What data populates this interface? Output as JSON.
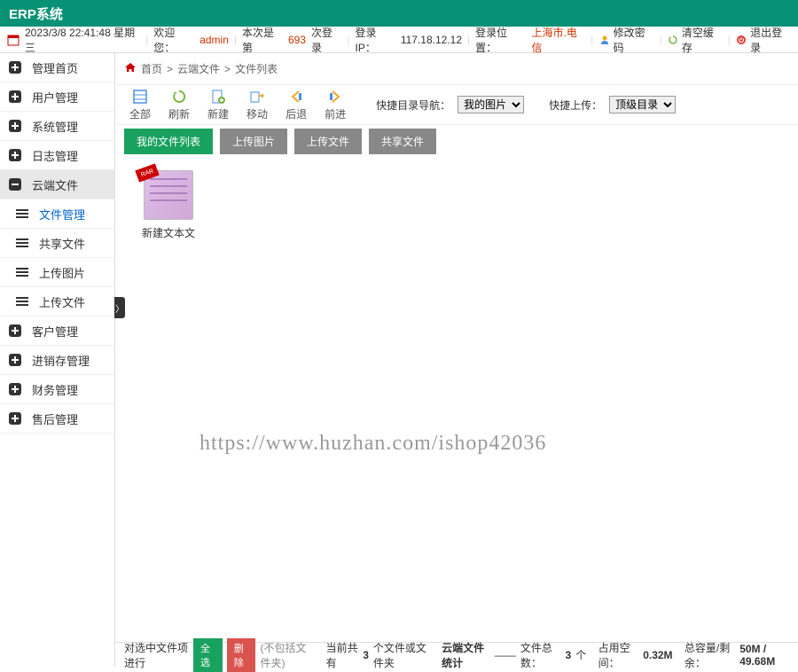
{
  "app_title": "ERP系统",
  "info_bar": {
    "datetime": "2023/3/8 22:41:48 星期三",
    "welcome": "欢迎您：",
    "user": "admin",
    "login_count_pre": "本次是第",
    "login_count": "693",
    "login_count_post": "次登录",
    "login_ip_label": "登录IP：",
    "login_ip": "117.18.12.12",
    "login_loc_label": "登录位置：",
    "login_loc": "上海市.电信",
    "change_pwd": "修改密码",
    "clear_cache": "清空缓存",
    "logout": "退出登录"
  },
  "sidebar": {
    "items": [
      {
        "label": "管理首页",
        "type": "plus"
      },
      {
        "label": "用户管理",
        "type": "plus"
      },
      {
        "label": "系统管理",
        "type": "plus"
      },
      {
        "label": "日志管理",
        "type": "plus"
      },
      {
        "label": "云端文件",
        "type": "minus",
        "section_active": true
      },
      {
        "label": "文件管理",
        "type": "list",
        "sub": true,
        "active": true
      },
      {
        "label": "共享文件",
        "type": "list",
        "sub": true
      },
      {
        "label": "上传图片",
        "type": "list",
        "sub": true
      },
      {
        "label": "上传文件",
        "type": "list",
        "sub": true
      },
      {
        "label": "客户管理",
        "type": "plus"
      },
      {
        "label": "进销存管理",
        "type": "plus"
      },
      {
        "label": "财务管理",
        "type": "plus"
      },
      {
        "label": "售后管理",
        "type": "plus"
      }
    ]
  },
  "breadcrumb": {
    "home": "首页",
    "sep": ">",
    "l1": "云端文件",
    "l2": "文件列表"
  },
  "toolbar": {
    "all": "全部",
    "refresh": "刷新",
    "new": "新建",
    "move": "移动",
    "back": "后退",
    "forward": "前进",
    "quick_nav": "快捷目录导航：",
    "quick_nav_sel": "我的图片",
    "quick_upload": "快捷上传：",
    "quick_upload_sel": "顶级目录"
  },
  "tabs": {
    "t1": "我的文件列表",
    "t2": "上传图片",
    "t3": "上传文件",
    "t4": "共享文件"
  },
  "file": {
    "badge": "RAR",
    "name": "新建文本文"
  },
  "watermark": "https://www.huzhan.com/ishop42036",
  "footer": {
    "label": "对选中文件项进行",
    "select_all": "全选",
    "delete": "删除",
    "note": "(不包括文件夹)",
    "cur_pre": "当前共有",
    "cur_n": "3",
    "cur_post": "个文件或文件夹",
    "stat_title": "云端文件统计",
    "dash": "——",
    "total_pre": "文件总数：",
    "total_n": "3",
    "total_post": "个",
    "space_pre": "占用空间：",
    "space": "0.32M",
    "cap_pre": "总容量/剩余：",
    "cap": "50M / 49.68M"
  }
}
